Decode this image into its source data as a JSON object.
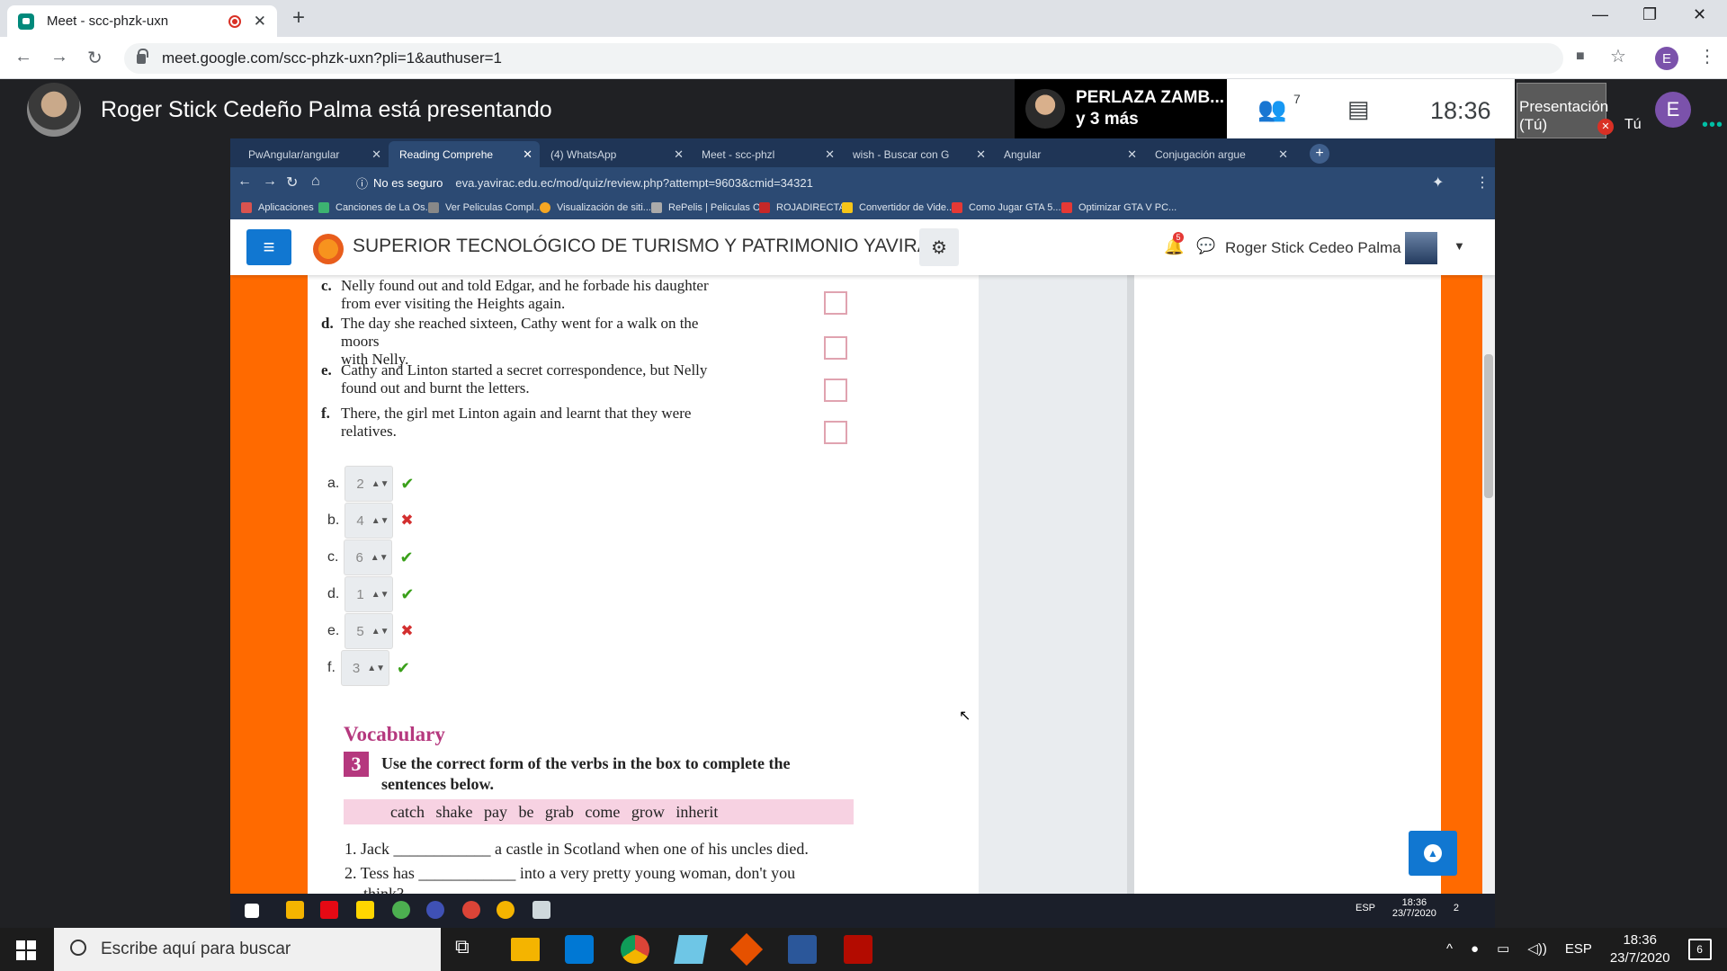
{
  "browser": {
    "tab_title": "Meet - scc-phzk-uxn",
    "url": "meet.google.com/scc-phzk-uxn?pli=1&authuser=1",
    "profile_initial": "E"
  },
  "meet": {
    "presenter_title": "Roger Stick Cedeño Palma está presentando",
    "participant_name": "PERLAZA ZAMB...",
    "participant_more": "y 3 más",
    "people_count": "7",
    "time": "18:36",
    "self_tile_label": "Presentación (Tú)",
    "self_label": "Tú",
    "self_initial": "E"
  },
  "inner_browser": {
    "tabs": [
      {
        "label": "PwAngular/angular"
      },
      {
        "label": "Reading Comprehe"
      },
      {
        "label": "(4) WhatsApp"
      },
      {
        "label": "Meet - scc-phzl"
      },
      {
        "label": "wish - Buscar con G"
      },
      {
        "label": "Angular"
      },
      {
        "label": "Conjugación argue"
      }
    ],
    "security": "No es seguro",
    "url": "eva.yavirac.edu.ec/mod/quiz/review.php?attempt=9603&cmid=34321",
    "bookmarks": [
      {
        "label": "Aplicaciones"
      },
      {
        "label": "Canciones de La Os..."
      },
      {
        "label": "Ver Peliculas Compl..."
      },
      {
        "label": "Visualización de siti..."
      },
      {
        "label": "RePelis | Peliculas O..."
      },
      {
        "label": "ROJADIRECTA"
      },
      {
        "label": "Convertidor de Vide..."
      },
      {
        "label": "Como Jugar GTA 5..."
      },
      {
        "label": "Optimizar GTA V PC..."
      }
    ]
  },
  "moodle": {
    "site_title": "SUPERIOR TECNOLÓGICO DE TURISMO Y PATRIMONIO YAVIRAC",
    "notif_count": "5",
    "user_name": "Roger Stick Cedeo Palma"
  },
  "quiz": {
    "statements": [
      {
        "letter": "c.",
        "l1": "Nelly found out and told Edgar, and he forbade his daughter",
        "l2": "from ever visiting the Heights again."
      },
      {
        "letter": "d.",
        "l1": "The day she reached sixteen, Cathy went for a walk on the moors",
        "l2": "with Nelly."
      },
      {
        "letter": "e.",
        "l1": "Cathy and Linton started a secret correspondence, but Nelly",
        "l2": "found out and burnt the letters."
      },
      {
        "letter": "f.",
        "l1": "There, the girl met Linton again and learnt that they were",
        "l2": "relatives."
      }
    ],
    "answers": [
      {
        "label": "a.",
        "value": "2",
        "correct": true
      },
      {
        "label": "b.",
        "value": "4",
        "correct": false
      },
      {
        "label": "c.",
        "value": "6",
        "correct": true
      },
      {
        "label": "d.",
        "value": "1",
        "correct": true
      },
      {
        "label": "e.",
        "value": "5",
        "correct": false
      },
      {
        "label": "f.",
        "value": "3",
        "correct": true
      }
    ],
    "vocab_heading": "Vocabulary",
    "exercise_number": "3",
    "instruction": "Use the correct form of the verbs in the box to complete the sentences below.",
    "word_box": "catch   shake   pay   be   grab   come   grow   inherit",
    "sentences": [
      "1. Jack ____________ a castle in Scotland when one of his uncles died.",
      "2. Tess has ____________ into a very pretty young woman, don't you"
    ],
    "sentence_cont": "think?"
  },
  "inner_taskbar": {
    "time": "18:36",
    "date": "23/7/2020",
    "lang": "ESP",
    "notif": "2"
  },
  "taskbar": {
    "search_placeholder": "Escribe aquí para buscar",
    "lang": "ESP",
    "time": "18:36",
    "date": "23/7/2020",
    "notif": "6"
  }
}
